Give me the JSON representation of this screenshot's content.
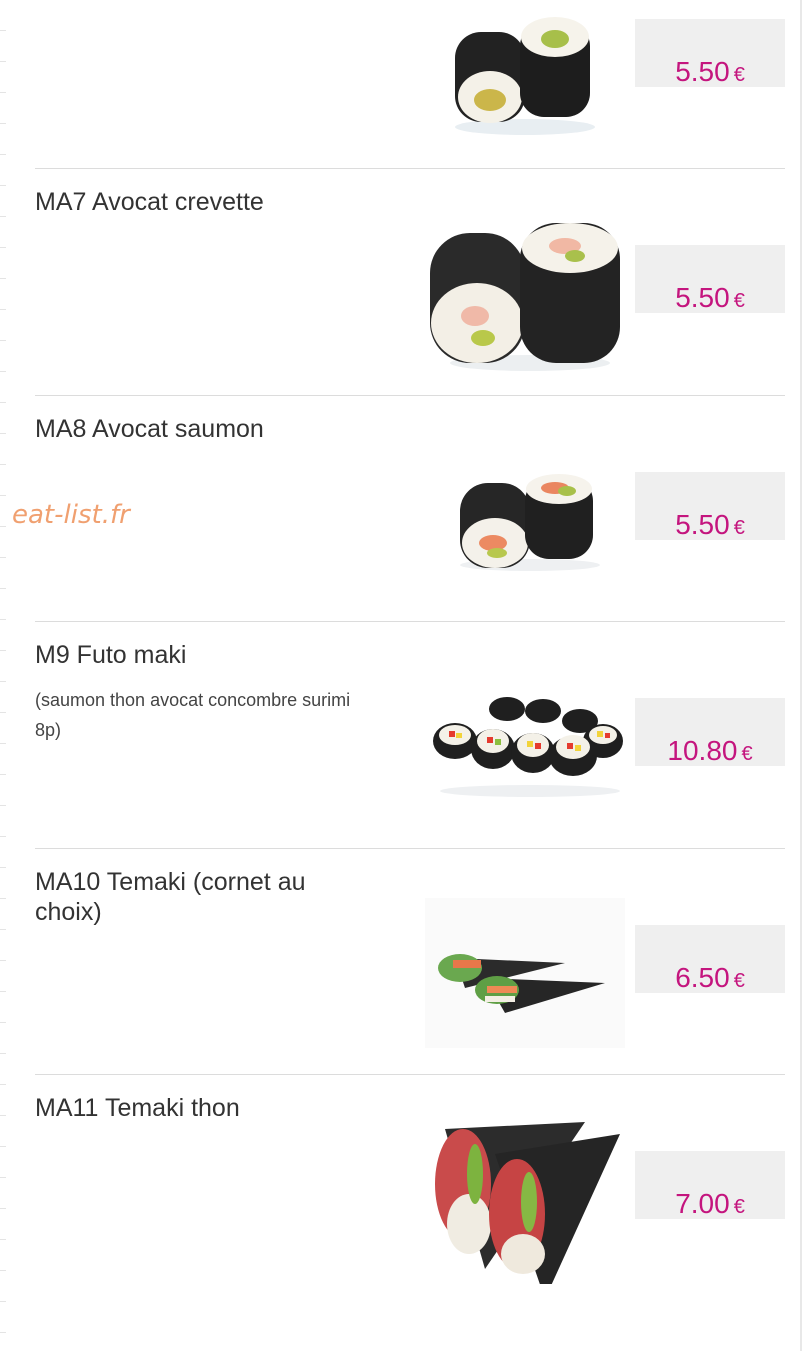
{
  "watermark": "eat-list.fr",
  "currency": "€",
  "items": [
    {
      "name": "",
      "description": "",
      "price": "5.50",
      "image": "maki-roll-image"
    },
    {
      "name": "MA7 Avocat crevette",
      "description": "",
      "price": "5.50",
      "image": "avocado-shrimp-maki-image"
    },
    {
      "name": "MA8 Avocat saumon",
      "description": "",
      "price": "5.50",
      "image": "avocado-salmon-maki-image"
    },
    {
      "name": "M9 Futo maki",
      "description": "(saumon thon avocat concombre surimi 8p)",
      "price": "10.80",
      "image": "futo-maki-image"
    },
    {
      "name": "MA10 Temaki (cornet au choix)",
      "description": "",
      "price": "6.50",
      "image": "temaki-cone-image"
    },
    {
      "name": "MA11 Temaki thon",
      "description": "",
      "price": "7.00",
      "image": "tuna-temaki-image"
    }
  ],
  "colors": {
    "price": "#c4157e",
    "price_box": "#efefef",
    "divider": "#dcdcdc",
    "watermark": "#f0a070"
  }
}
